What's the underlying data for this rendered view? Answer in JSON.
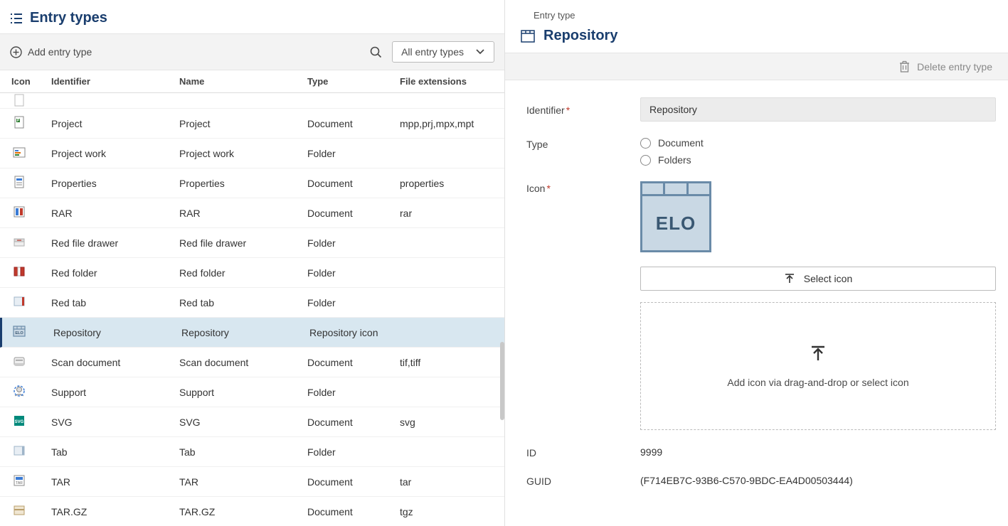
{
  "left": {
    "title": "Entry types",
    "add_label": "Add entry type",
    "filter_label": "All entry types",
    "columns": {
      "icon": "Icon",
      "identifier": "Identifier",
      "name": "Name",
      "type": "Type",
      "ext": "File extensions"
    },
    "rows": [
      {
        "identifier": "",
        "name": "",
        "type": "",
        "ext": "",
        "iconKey": "doc-generic",
        "partial": true
      },
      {
        "identifier": "Project",
        "name": "Project",
        "type": "Document",
        "ext": "mpp,prj,mpx,mpt",
        "iconKey": "project-doc"
      },
      {
        "identifier": "Project work",
        "name": "Project work",
        "type": "Folder",
        "ext": "",
        "iconKey": "project-work"
      },
      {
        "identifier": "Properties",
        "name": "Properties",
        "type": "Document",
        "ext": "properties",
        "iconKey": "properties-doc"
      },
      {
        "identifier": "RAR",
        "name": "RAR",
        "type": "Document",
        "ext": "rar",
        "iconKey": "rar-doc"
      },
      {
        "identifier": "Red file drawer",
        "name": "Red file drawer",
        "type": "Folder",
        "ext": "",
        "iconKey": "red-drawer"
      },
      {
        "identifier": "Red folder",
        "name": "Red folder",
        "type": "Folder",
        "ext": "",
        "iconKey": "red-folder"
      },
      {
        "identifier": "Red tab",
        "name": "Red tab",
        "type": "Folder",
        "ext": "",
        "iconKey": "red-tab"
      },
      {
        "identifier": "Repository",
        "name": "Repository",
        "type": "Repository icon",
        "ext": "",
        "iconKey": "repository",
        "selected": true
      },
      {
        "identifier": "Scan document",
        "name": "Scan document",
        "type": "Document",
        "ext": "tif,tiff",
        "iconKey": "scan-doc"
      },
      {
        "identifier": "Support",
        "name": "Support",
        "type": "Folder",
        "ext": "",
        "iconKey": "support"
      },
      {
        "identifier": "SVG",
        "name": "SVG",
        "type": "Document",
        "ext": "svg",
        "iconKey": "svg-doc"
      },
      {
        "identifier": "Tab",
        "name": "Tab",
        "type": "Folder",
        "ext": "",
        "iconKey": "tab"
      },
      {
        "identifier": "TAR",
        "name": "TAR",
        "type": "Document",
        "ext": "tar",
        "iconKey": "tar-doc"
      },
      {
        "identifier": "TAR.GZ",
        "name": "TAR.GZ",
        "type": "Document",
        "ext": "tgz",
        "iconKey": "targz-doc"
      }
    ]
  },
  "right": {
    "breadcrumb": "Entry type",
    "title": "Repository",
    "delete_label": "Delete entry type",
    "fields": {
      "identifier_label": "Identifier",
      "identifier_value": "Repository",
      "type_label": "Type",
      "type_options": {
        "document": "Document",
        "folders": "Folders"
      },
      "icon_label": "Icon",
      "icon_text": "ELO",
      "select_icon_label": "Select icon",
      "dropzone_label": "Add icon via drag-and-drop or select icon",
      "id_label": "ID",
      "id_value": "9999",
      "guid_label": "GUID",
      "guid_value": "(F714EB7C-93B6-C570-9BDC-EA4D00503444)"
    }
  }
}
